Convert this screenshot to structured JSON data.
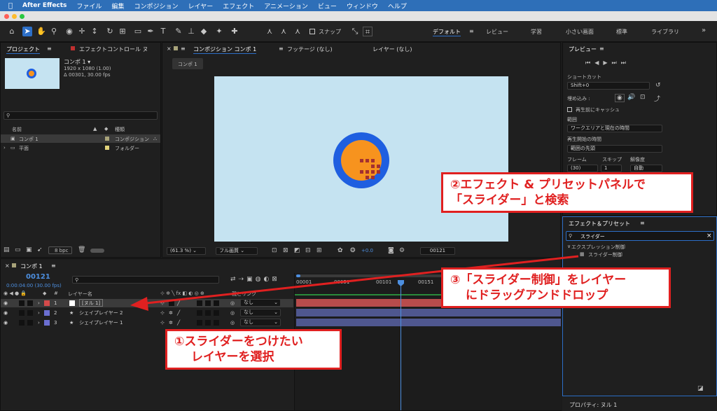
{
  "menubar": {
    "apple": "",
    "items": [
      "After Effects",
      "ファイル",
      "編集",
      "コンポジション",
      "レイヤー",
      "エフェクト",
      "アニメーション",
      "ビュー",
      "ウィンドウ",
      "ヘルプ"
    ]
  },
  "toolbar": {
    "snap_label": "スナップ",
    "workspaces": [
      "デフォルト",
      "レビュー",
      "学習",
      "小さい画面",
      "標準",
      "ライブラリ"
    ],
    "more": "»"
  },
  "project": {
    "tab_label": "プロジェクト",
    "effect_controls_tab": "エフェクトコントロール ヌ",
    "comp_name": "コンポ 1 ▾",
    "comp_res": "1920 x 1080 (1.00)",
    "comp_dur": "Δ 00301, 30.00 fps",
    "search_placeholder": "",
    "col_name": "名前",
    "col_type": "種類",
    "items": [
      {
        "name": "コンポ 1",
        "type": "コンポジション",
        "color": "#a8a37a"
      },
      {
        "name": "平面",
        "type": "フォルダー",
        "color": "#e0d27a"
      }
    ],
    "bpc": "8 bpc"
  },
  "comp": {
    "tab_label": "コンポジション コンポ 1",
    "footage_tab": "フッテージ (なし)",
    "layer_tab": "レイヤー (なし)",
    "breadcrumb": "コンポ 1",
    "zoom": "(61.3 %)",
    "quality": "フル画質",
    "exposure": "+0.0",
    "timecode": "00121",
    "canvas_bg": "#c5e3f1",
    "circle_outer": "#1f5fe0",
    "circle_inner": "#f7931e"
  },
  "preview": {
    "tab_label": "プレビュー",
    "shortcut_label": "ショートカット",
    "shortcut_value": "Shift+0",
    "include_label": "埋め込み :",
    "cache_label": "再生前にキャッシュ",
    "range_label": "範囲",
    "range_value": "ワークエリアと現在の時間",
    "start_label": "再生開始の時間",
    "start_value": "範囲の先頭",
    "frame_label": "フレーム",
    "skip_label": "スキップ",
    "res_label": "解像度",
    "frame_value": "(30)",
    "skip_value": "1",
    "res_value": "自動"
  },
  "effects": {
    "tab_label": "エフェクト＆プリセット",
    "search_value": "スライダー",
    "category": "エクスプレッション制御",
    "item": "スライダー制御"
  },
  "timeline": {
    "tab_label": "コンポ 1",
    "timecode": "00121",
    "time_sub": "0:00:04:00 (30.00 fps)",
    "col_layer_name": "レイヤー名",
    "col_parent": "親とリンク",
    "ruler_ticks": [
      "00001",
      "00051",
      "00101",
      "00151"
    ],
    "layers": [
      {
        "num": "1",
        "name": "[ヌル 1]",
        "color": "#d44a4a",
        "parent": "なし",
        "bar": "#b84c4c"
      },
      {
        "num": "2",
        "name": "シェイプレイヤー 2",
        "color": "#6b6fd1",
        "parent": "なし",
        "bar": "#4f578f"
      },
      {
        "num": "3",
        "name": "シェイプレイヤー 1",
        "color": "#6b6fd1",
        "parent": "なし",
        "bar": "#4f578f"
      }
    ]
  },
  "properties": {
    "label": "プロパティ: ヌル 1"
  },
  "callouts": {
    "c1_line1": "①スライダーをつけたい",
    "c1_line2": "レイヤーを選択",
    "c2_line1": "②エフェクト & プリセットパネルで",
    "c2_line2": "「スライダー」と検索",
    "c3_line1": "③「スライダー制御」をレイヤー",
    "c3_line2": "にドラッグアンドドロップ"
  }
}
